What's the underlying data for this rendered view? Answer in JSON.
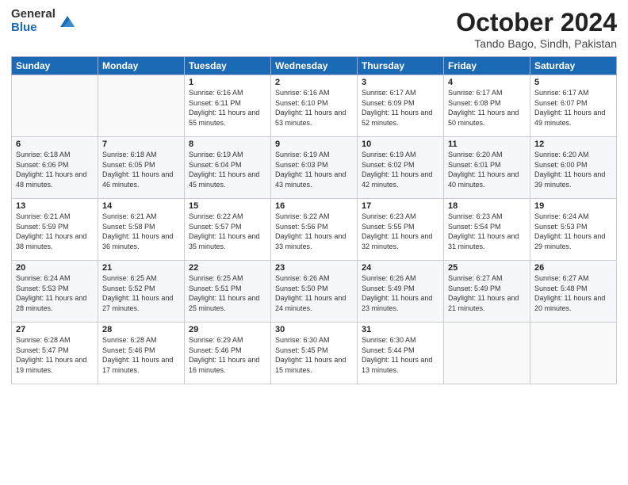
{
  "logo": {
    "general": "General",
    "blue": "Blue"
  },
  "header": {
    "month": "October 2024",
    "location": "Tando Bago, Sindh, Pakistan"
  },
  "days_of_week": [
    "Sunday",
    "Monday",
    "Tuesday",
    "Wednesday",
    "Thursday",
    "Friday",
    "Saturday"
  ],
  "weeks": [
    [
      {
        "day": "",
        "info": ""
      },
      {
        "day": "",
        "info": ""
      },
      {
        "day": "1",
        "info": "Sunrise: 6:16 AM\nSunset: 6:11 PM\nDaylight: 11 hours and 55 minutes."
      },
      {
        "day": "2",
        "info": "Sunrise: 6:16 AM\nSunset: 6:10 PM\nDaylight: 11 hours and 53 minutes."
      },
      {
        "day": "3",
        "info": "Sunrise: 6:17 AM\nSunset: 6:09 PM\nDaylight: 11 hours and 52 minutes."
      },
      {
        "day": "4",
        "info": "Sunrise: 6:17 AM\nSunset: 6:08 PM\nDaylight: 11 hours and 50 minutes."
      },
      {
        "day": "5",
        "info": "Sunrise: 6:17 AM\nSunset: 6:07 PM\nDaylight: 11 hours and 49 minutes."
      }
    ],
    [
      {
        "day": "6",
        "info": "Sunrise: 6:18 AM\nSunset: 6:06 PM\nDaylight: 11 hours and 48 minutes."
      },
      {
        "day": "7",
        "info": "Sunrise: 6:18 AM\nSunset: 6:05 PM\nDaylight: 11 hours and 46 minutes."
      },
      {
        "day": "8",
        "info": "Sunrise: 6:19 AM\nSunset: 6:04 PM\nDaylight: 11 hours and 45 minutes."
      },
      {
        "day": "9",
        "info": "Sunrise: 6:19 AM\nSunset: 6:03 PM\nDaylight: 11 hours and 43 minutes."
      },
      {
        "day": "10",
        "info": "Sunrise: 6:19 AM\nSunset: 6:02 PM\nDaylight: 11 hours and 42 minutes."
      },
      {
        "day": "11",
        "info": "Sunrise: 6:20 AM\nSunset: 6:01 PM\nDaylight: 11 hours and 40 minutes."
      },
      {
        "day": "12",
        "info": "Sunrise: 6:20 AM\nSunset: 6:00 PM\nDaylight: 11 hours and 39 minutes."
      }
    ],
    [
      {
        "day": "13",
        "info": "Sunrise: 6:21 AM\nSunset: 5:59 PM\nDaylight: 11 hours and 38 minutes."
      },
      {
        "day": "14",
        "info": "Sunrise: 6:21 AM\nSunset: 5:58 PM\nDaylight: 11 hours and 36 minutes."
      },
      {
        "day": "15",
        "info": "Sunrise: 6:22 AM\nSunset: 5:57 PM\nDaylight: 11 hours and 35 minutes."
      },
      {
        "day": "16",
        "info": "Sunrise: 6:22 AM\nSunset: 5:56 PM\nDaylight: 11 hours and 33 minutes."
      },
      {
        "day": "17",
        "info": "Sunrise: 6:23 AM\nSunset: 5:55 PM\nDaylight: 11 hours and 32 minutes."
      },
      {
        "day": "18",
        "info": "Sunrise: 6:23 AM\nSunset: 5:54 PM\nDaylight: 11 hours and 31 minutes."
      },
      {
        "day": "19",
        "info": "Sunrise: 6:24 AM\nSunset: 5:53 PM\nDaylight: 11 hours and 29 minutes."
      }
    ],
    [
      {
        "day": "20",
        "info": "Sunrise: 6:24 AM\nSunset: 5:53 PM\nDaylight: 11 hours and 28 minutes."
      },
      {
        "day": "21",
        "info": "Sunrise: 6:25 AM\nSunset: 5:52 PM\nDaylight: 11 hours and 27 minutes."
      },
      {
        "day": "22",
        "info": "Sunrise: 6:25 AM\nSunset: 5:51 PM\nDaylight: 11 hours and 25 minutes."
      },
      {
        "day": "23",
        "info": "Sunrise: 6:26 AM\nSunset: 5:50 PM\nDaylight: 11 hours and 24 minutes."
      },
      {
        "day": "24",
        "info": "Sunrise: 6:26 AM\nSunset: 5:49 PM\nDaylight: 11 hours and 23 minutes."
      },
      {
        "day": "25",
        "info": "Sunrise: 6:27 AM\nSunset: 5:49 PM\nDaylight: 11 hours and 21 minutes."
      },
      {
        "day": "26",
        "info": "Sunrise: 6:27 AM\nSunset: 5:48 PM\nDaylight: 11 hours and 20 minutes."
      }
    ],
    [
      {
        "day": "27",
        "info": "Sunrise: 6:28 AM\nSunset: 5:47 PM\nDaylight: 11 hours and 19 minutes."
      },
      {
        "day": "28",
        "info": "Sunrise: 6:28 AM\nSunset: 5:46 PM\nDaylight: 11 hours and 17 minutes."
      },
      {
        "day": "29",
        "info": "Sunrise: 6:29 AM\nSunset: 5:46 PM\nDaylight: 11 hours and 16 minutes."
      },
      {
        "day": "30",
        "info": "Sunrise: 6:30 AM\nSunset: 5:45 PM\nDaylight: 11 hours and 15 minutes."
      },
      {
        "day": "31",
        "info": "Sunrise: 6:30 AM\nSunset: 5:44 PM\nDaylight: 11 hours and 13 minutes."
      },
      {
        "day": "",
        "info": ""
      },
      {
        "day": "",
        "info": ""
      }
    ]
  ]
}
